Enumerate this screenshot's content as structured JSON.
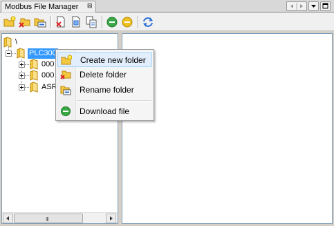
{
  "tab": {
    "title": "Modbus File Manager",
    "close_glyph": "⊠"
  },
  "tab_controls": [
    {
      "icon": "scroll-left-icon"
    },
    {
      "icon": "scroll-right-icon"
    },
    {
      "icon": "dropdown-arrow-icon"
    },
    {
      "icon": "maximize-icon"
    }
  ],
  "toolbar": [
    {
      "icon": "new-folder-icon"
    },
    {
      "icon": "delete-folder-icon"
    },
    {
      "icon": "rename-folder-icon"
    },
    {
      "icon": "delete-file-icon"
    },
    {
      "icon": "file-properties-icon"
    },
    {
      "icon": "copy-file-icon"
    },
    {
      "icon": "download-file-icon"
    },
    {
      "icon": "upload-file-icon"
    },
    {
      "icon": "refresh-icon"
    }
  ],
  "tree": {
    "root": "\\",
    "selected": "PLC300",
    "children": [
      "000",
      "000",
      "ASR"
    ]
  },
  "context_menu": {
    "items": [
      {
        "label": "Create new folder",
        "icon": "new-folder-icon"
      },
      {
        "label": "Delete folder",
        "icon": "delete-folder-icon"
      },
      {
        "label": "Rename folder",
        "icon": "rename-folder-icon"
      },
      {
        "label": "Download file",
        "icon": "download-file-icon"
      }
    ]
  },
  "scrollbar": {
    "grip": "III"
  },
  "colors": {
    "selection": "#3399ff",
    "border": "#7f9db9",
    "menu_highlight": "#e2eefb",
    "folder": "#f5c842",
    "download_green": "#3aa845",
    "upload_yellow": "#f0c020",
    "refresh_blue": "#2a6fd6"
  }
}
